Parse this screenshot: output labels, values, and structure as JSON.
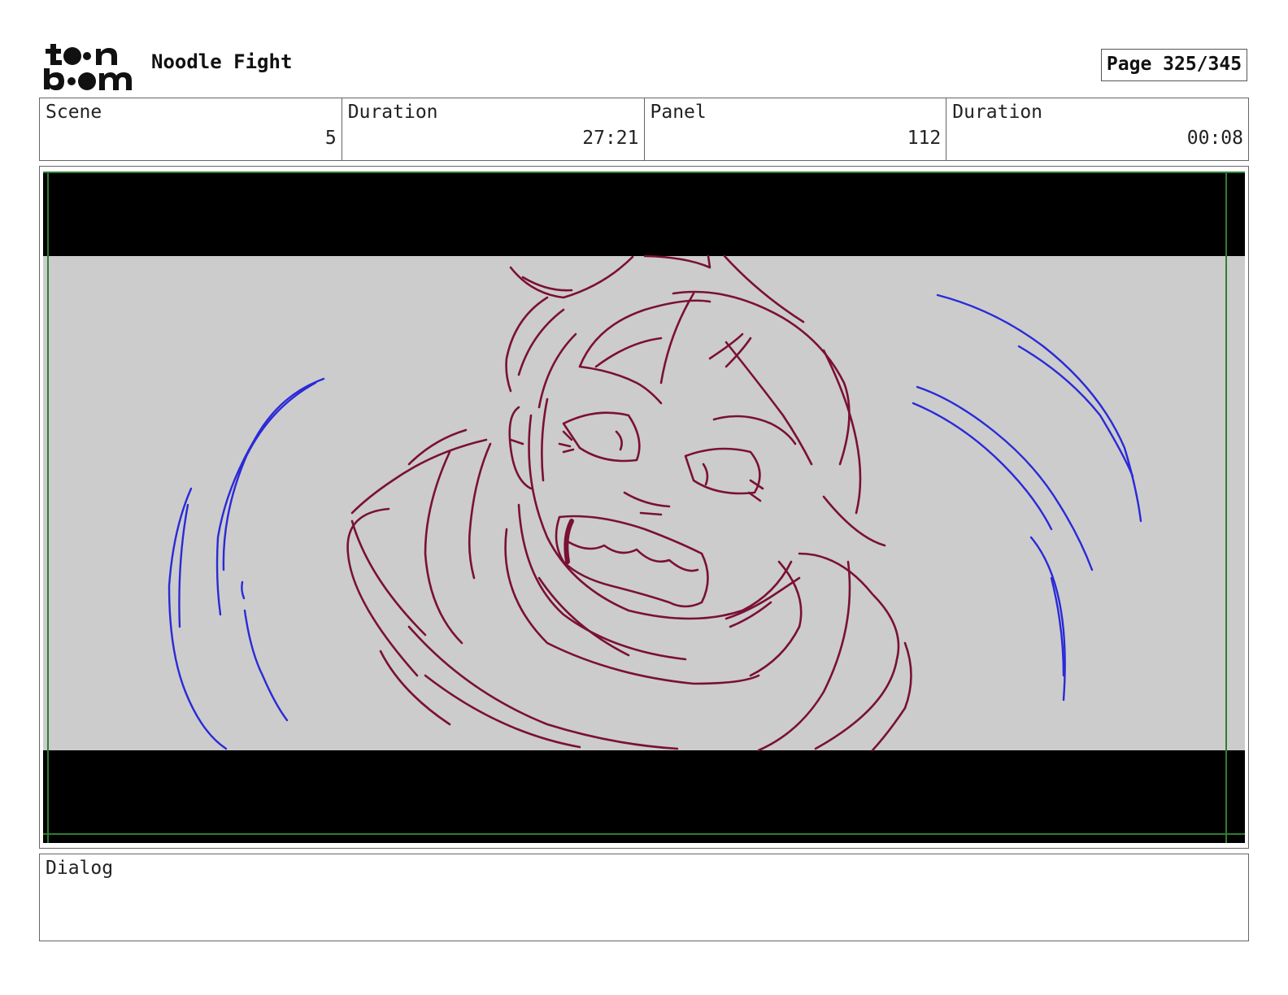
{
  "header": {
    "logo_text": "toon boom",
    "project_title": "Noodle Fight",
    "page_label": "Page 325/345"
  },
  "info": {
    "scene_label": "Scene",
    "scene_value": "5",
    "scene_duration_label": "Duration",
    "scene_duration_value": "27:21",
    "panel_label": "Panel",
    "panel_value": "112",
    "panel_duration_label": "Duration",
    "panel_duration_value": "00:08"
  },
  "panel": {
    "letterbox_color": "#000000",
    "background_color": "#cccccc",
    "safe_area_color": "#2e7d32",
    "character_line_color": "#7a1036",
    "motion_line_color": "#2a2ad8"
  },
  "dialog": {
    "label": "Dialog",
    "text": ""
  }
}
